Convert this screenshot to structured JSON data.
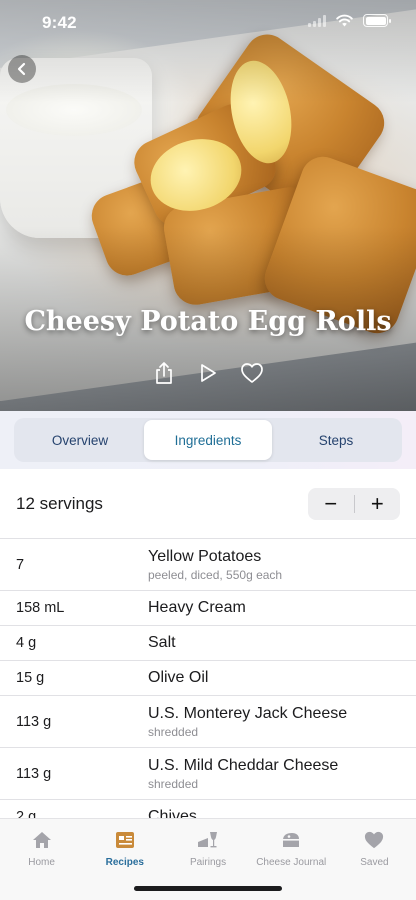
{
  "status_bar": {
    "time": "9:42"
  },
  "hero": {
    "title": "Cheesy Potato Egg Rolls",
    "actions": [
      "share-icon",
      "play-icon",
      "heart-icon"
    ]
  },
  "tabs": {
    "items": [
      "Overview",
      "Ingredients",
      "Steps"
    ],
    "active": "Ingredients"
  },
  "servings": {
    "label": "12 servings",
    "minus": "−",
    "plus": "+"
  },
  "ingredients": [
    {
      "qty": "7",
      "name": "Yellow Potatoes",
      "note": "peeled, diced, 550g each"
    },
    {
      "qty": "158 mL",
      "name": "Heavy Cream",
      "note": ""
    },
    {
      "qty": "4 g",
      "name": "Salt",
      "note": ""
    },
    {
      "qty": "15 g",
      "name": "Olive Oil",
      "note": ""
    },
    {
      "qty": "113 g",
      "name": "U.S. Monterey Jack Cheese",
      "note": "shredded"
    },
    {
      "qty": "113 g",
      "name": "U.S. Mild Cheddar Cheese",
      "note": "shredded"
    },
    {
      "qty": "2 g",
      "name": "Chives",
      "note": ""
    }
  ],
  "tab_bar": {
    "items": [
      {
        "label": "Home",
        "icon": "house-icon"
      },
      {
        "label": "Recipes",
        "icon": "recipe-card-icon"
      },
      {
        "label": "Pairings",
        "icon": "wine-cheese-icon"
      },
      {
        "label": "Cheese Journal",
        "icon": "cheese-journal-icon"
      },
      {
        "label": "Saved",
        "icon": "heart-icon"
      }
    ],
    "active": "Recipes"
  },
  "colors": {
    "accent": "#2a6e9c",
    "tab_inactive": "#9a9aa0",
    "segment_text": "#26436e"
  }
}
